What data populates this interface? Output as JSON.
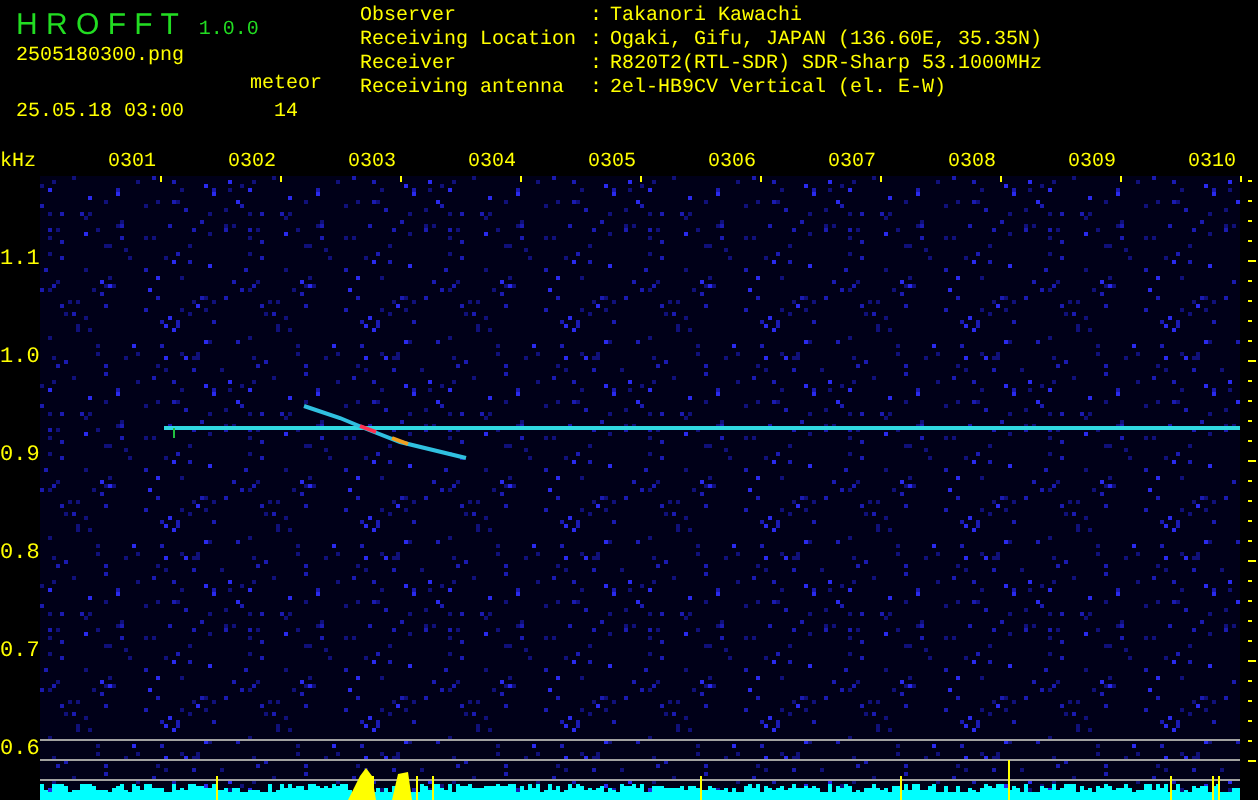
{
  "app": {
    "name": "H R O F F T",
    "version": "1.0.0",
    "filename": "2505180300.png",
    "timestamp": "25.05.18 03:00",
    "count_label": "meteor",
    "count": "14"
  },
  "info": [
    {
      "label": "Observer",
      "separator": ":",
      "value": "Takanori Kawachi"
    },
    {
      "label": "Receiving Location",
      "separator": ":",
      "value": "Ogaki, Gifu, JAPAN (136.60E, 35.35N)"
    },
    {
      "label": "Receiver",
      "separator": ":",
      "value": "R820T2(RTL-SDR) SDR-Sharp 53.1000MHz"
    },
    {
      "label": "Receiving antenna",
      "separator": ":",
      "value": "2el-HB9CV Vertical (el. E-W)"
    }
  ],
  "spectrogram": {
    "unit": "kHz",
    "time_labels": [
      "0301",
      "0302",
      "0303",
      "0304",
      "0305",
      "0306",
      "0307",
      "0308",
      "0309",
      "0310"
    ],
    "freq_labels": [
      "1.1",
      "1.0",
      "0.9",
      "0.8",
      "0.7",
      "0.6"
    ]
  }
}
